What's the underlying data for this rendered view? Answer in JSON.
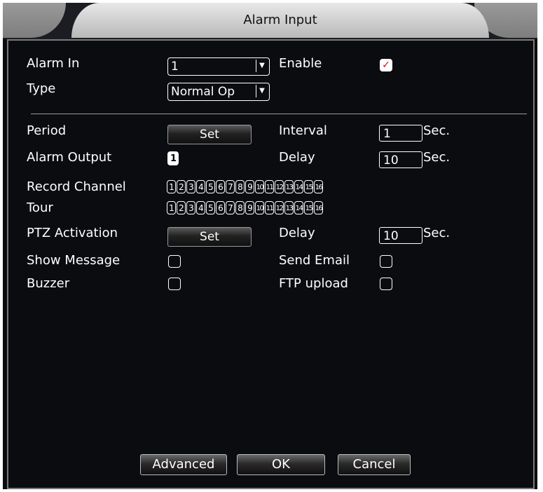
{
  "window": {
    "title": "Alarm Input"
  },
  "alarm_in": {
    "label": "Alarm In",
    "value": "1"
  },
  "enable": {
    "label": "Enable",
    "checked": true
  },
  "type": {
    "label": "Type",
    "value": "Normal Op"
  },
  "period": {
    "label": "Period",
    "button": "Set"
  },
  "interval": {
    "label": "Interval",
    "value": "1",
    "unit": "Sec."
  },
  "alarm_output": {
    "label": "Alarm Output",
    "value": "1",
    "selected": true
  },
  "delay1": {
    "label": "Delay",
    "value": "10",
    "unit": "Sec."
  },
  "record_channel": {
    "label": "Record Channel",
    "channels": [
      "1",
      "2",
      "3",
      "4",
      "5",
      "6",
      "7",
      "8",
      "9",
      "10",
      "11",
      "12",
      "13",
      "14",
      "15",
      "16"
    ]
  },
  "tour": {
    "label": "Tour",
    "channels": [
      "1",
      "2",
      "3",
      "4",
      "5",
      "6",
      "7",
      "8",
      "9",
      "10",
      "11",
      "12",
      "13",
      "14",
      "15",
      "16"
    ]
  },
  "ptz_activation": {
    "label": "PTZ Activation",
    "button": "Set"
  },
  "delay2": {
    "label": "Delay",
    "value": "10",
    "unit": "Sec."
  },
  "show_message": {
    "label": "Show Message",
    "checked": false
  },
  "send_email": {
    "label": "Send Email",
    "checked": false
  },
  "buzzer": {
    "label": "Buzzer",
    "checked": false
  },
  "ftp_upload": {
    "label": "FTP upload",
    "checked": false
  },
  "footer": {
    "advanced": "Advanced",
    "ok": "OK",
    "cancel": "Cancel"
  },
  "colors": {
    "background": "#0a0c10",
    "text": "#ffffff",
    "check_mark": "#d21010"
  }
}
